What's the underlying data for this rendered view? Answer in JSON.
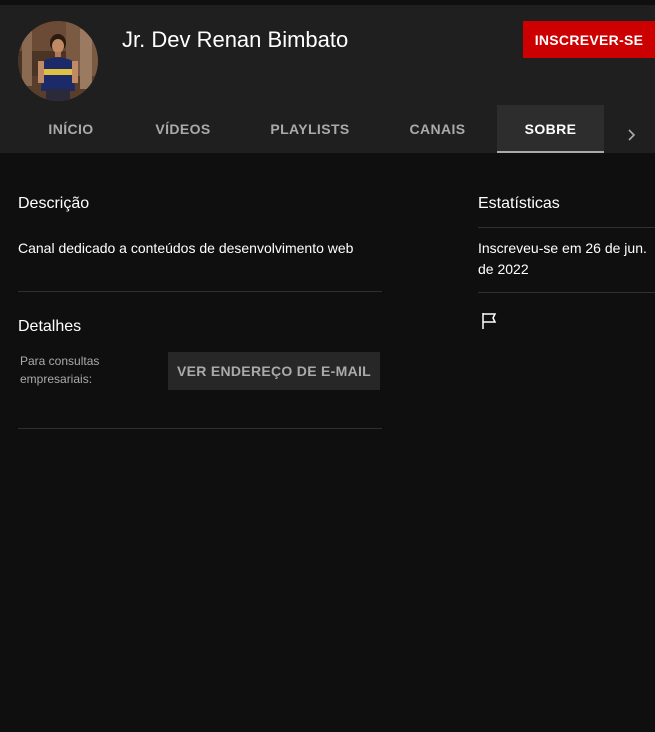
{
  "channel": {
    "name": "Jr. Dev Renan Bimbato",
    "subscribe_label": "INSCREVER-SE",
    "avatar_icon": "avatar-photo"
  },
  "tabs": [
    {
      "label": "INÍCIO",
      "active": false
    },
    {
      "label": "VÍDEOS",
      "active": false
    },
    {
      "label": "PLAYLISTS",
      "active": false
    },
    {
      "label": "CANAIS",
      "active": false
    },
    {
      "label": "SOBRE",
      "active": true
    }
  ],
  "tabs_next_icon": "chevron-right-icon",
  "about": {
    "description_title": "Descrição",
    "description_text": "Canal dedicado a conteúdos de desenvolvimento web",
    "details_title": "Detalhes",
    "business_label_line1": "Para consultas",
    "business_label_line2": "empresariais:",
    "email_button_label": "VER ENDEREÇO DE E-MAIL"
  },
  "stats": {
    "title": "Estatísticas",
    "joined_line1": "Inscreveu-se em 26 de jun.",
    "joined_line2": "de 2022",
    "report_icon": "flag-icon"
  },
  "colors": {
    "background": "#0f0f0f",
    "header": "#1f1f1f",
    "subscribe": "#cc0000",
    "active_tab": "#2d2d2d"
  }
}
